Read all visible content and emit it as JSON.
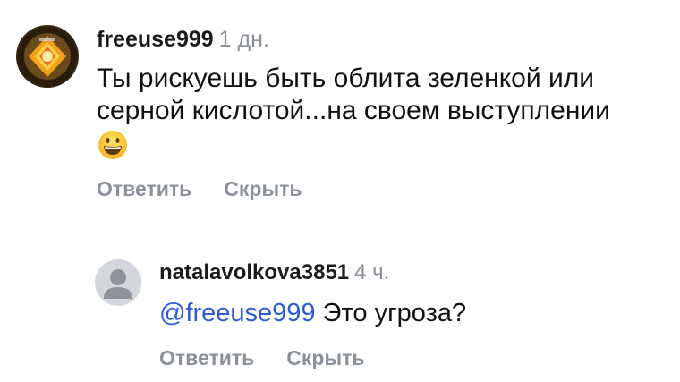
{
  "comments": [
    {
      "username": "freeuse999",
      "time": "1 дн.",
      "text_line1": "Ты рискуешь быть облита зеленкой или",
      "text_line2": "серной кислотой...на своем выступлении",
      "emoji": "grinning-face-emoji",
      "reply_label": "Ответить",
      "hide_label": "Скрыть"
    },
    {
      "username": "natalavolkova3851",
      "time": "4 ч.",
      "mention": "@freeuse999",
      "text": " Это угроза?",
      "reply_label": "Ответить",
      "hide_label": "Скрыть"
    }
  ],
  "colors": {
    "mention": "#2f5bd6",
    "muted": "#8b9199",
    "text": "#111111"
  }
}
